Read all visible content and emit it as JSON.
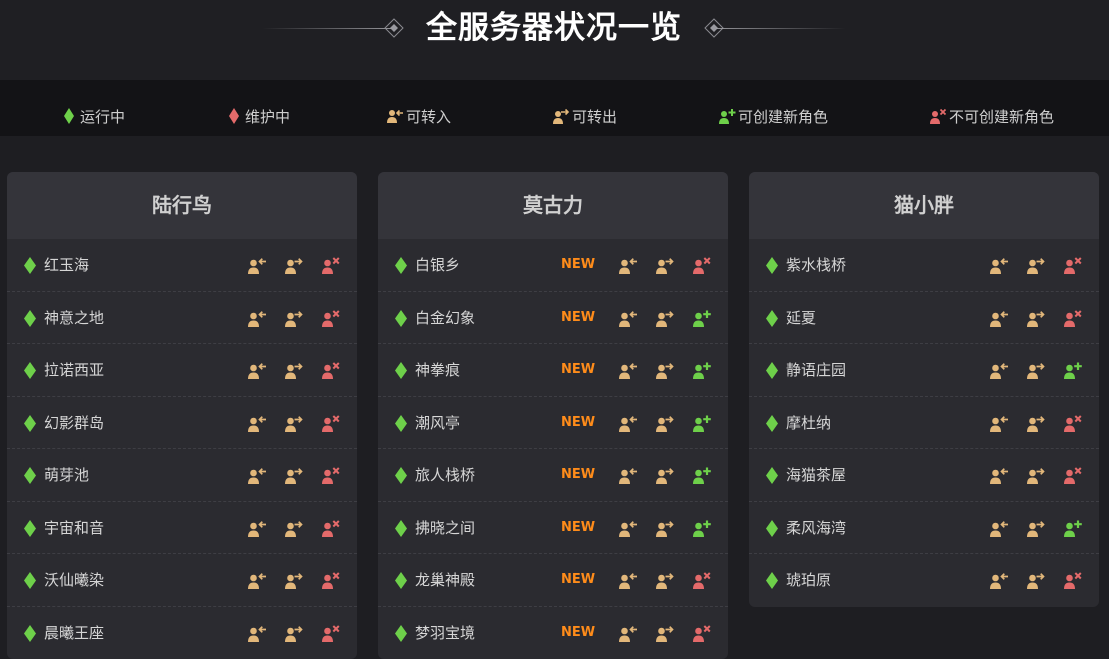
{
  "page_title": "全服务器状况一览",
  "legend": [
    {
      "label": "运行中",
      "icon": "green-diamond-icon"
    },
    {
      "label": "维护中",
      "icon": "red-diamond-icon"
    },
    {
      "label": "可转入",
      "icon": "transfer-in-icon"
    },
    {
      "label": "可转出",
      "icon": "transfer-out-icon"
    },
    {
      "label": "可创建新角色",
      "icon": "create-allowed-icon"
    },
    {
      "label": "不可创建新角色",
      "icon": "create-forbidden-icon"
    }
  ],
  "colors": {
    "running": "#6ed04a",
    "maintenance": "#e46a6a",
    "transfer": "#e2b77a",
    "new_badge": "#ff8c1a"
  },
  "datacenters": [
    {
      "name": "陆行鸟",
      "servers": [
        {
          "name": "红玉海",
          "new": "",
          "can_create": false
        },
        {
          "name": "神意之地",
          "new": "",
          "can_create": false
        },
        {
          "name": "拉诺西亚",
          "new": "",
          "can_create": false
        },
        {
          "name": "幻影群岛",
          "new": "",
          "can_create": false
        },
        {
          "name": "萌芽池",
          "new": "",
          "can_create": false
        },
        {
          "name": "宇宙和音",
          "new": "",
          "can_create": false
        },
        {
          "name": "沃仙曦染",
          "new": "",
          "can_create": false
        },
        {
          "name": "晨曦王座",
          "new": "",
          "can_create": false
        }
      ]
    },
    {
      "name": "莫古力",
      "servers": [
        {
          "name": "白银乡",
          "new": "NEW",
          "can_create": false
        },
        {
          "name": "白金幻象",
          "new": "NEW",
          "can_create": true
        },
        {
          "name": "神拳痕",
          "new": "NEW",
          "can_create": true
        },
        {
          "name": "潮风亭",
          "new": "NEW",
          "can_create": true
        },
        {
          "name": "旅人栈桥",
          "new": "NEW",
          "can_create": true
        },
        {
          "name": "拂晓之间",
          "new": "NEW",
          "can_create": true
        },
        {
          "name": "龙巢神殿",
          "new": "NEW",
          "can_create": false
        },
        {
          "name": "梦羽宝境",
          "new": "NEW",
          "can_create": false
        }
      ]
    },
    {
      "name": "猫小胖",
      "servers": [
        {
          "name": "紫水栈桥",
          "new": "",
          "can_create": false
        },
        {
          "name": "延夏",
          "new": "",
          "can_create": false
        },
        {
          "name": "静语庄园",
          "new": "",
          "can_create": true
        },
        {
          "name": "摩杜纳",
          "new": "",
          "can_create": false
        },
        {
          "name": "海猫茶屋",
          "new": "",
          "can_create": false
        },
        {
          "name": "柔风海湾",
          "new": "",
          "can_create": true
        },
        {
          "name": "琥珀原",
          "new": "",
          "can_create": false
        }
      ]
    }
  ]
}
